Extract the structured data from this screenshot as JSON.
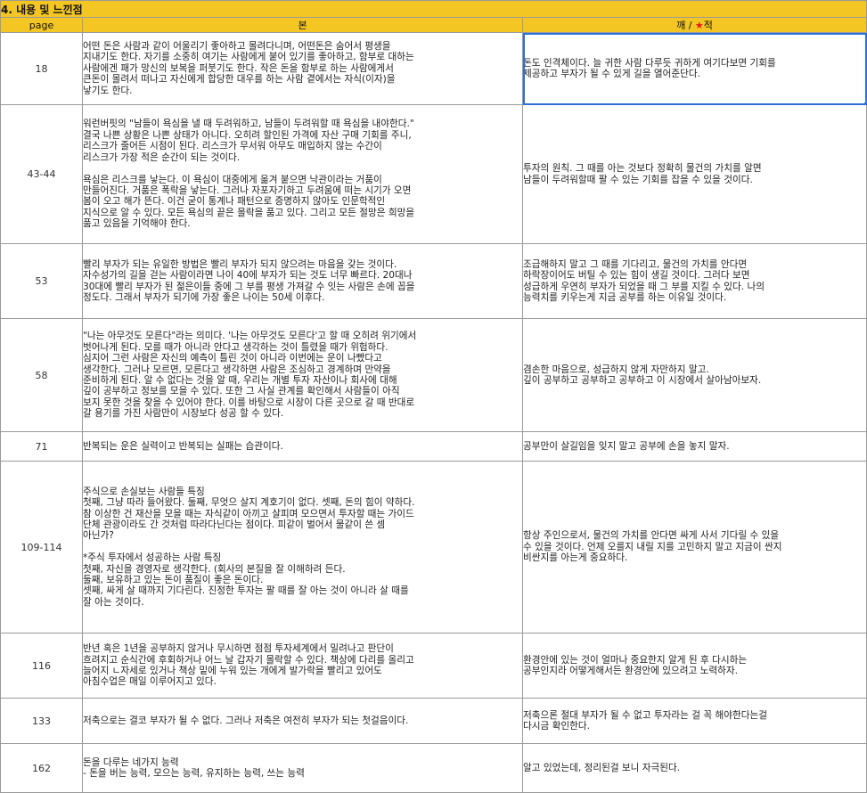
{
  "section_title": "4. 내용 및 느낀점",
  "headers": {
    "page": "page",
    "bon": "본",
    "kkae_prefix": "깨 / ",
    "star": "★",
    "kkae_suffix": "적"
  },
  "rows": [
    {
      "page": "18",
      "bon": "어떤 돈은 사람과 같이 어울리기 좋아하고 몰려다니며, 어떤돈은 숨어서 평생을\n지내기도 한다. 자기를 소중히 여기는 사람에게 붙어 있기를 좋아하고, 함부로 대하는\n사람에겐 패가 망신의 보복을 퍼붓기도 한다. 작은 돈을 함부로 하는 사람에게서\n큰돈이 몰려서 떠나고 자신에게 합당한 대우를 하는 사람 곁에서는 자식(이자)을\n낳기도 한다.",
      "kkae": "돈도 인격체이다. 늘 귀한 사람 다루듯 귀하게 여기다보면 기회를\n제공하고 부자가 될 수 있게 길을 열어준단다."
    },
    {
      "page": "43-44",
      "bon": "워런버핏의 \"남들이 욕심을 낼 때 두려워하고, 남들이 두려워할 때 욕심을 내야한다.\"\n결국 나쁜 상황은 나쁜 상태가 아니다. 오히려 할인된 가격에 자산 구매 기회를 주니,\n리스크가 줄어든 시점이 된다. 리스크가 무서워 아무도 매입하지 않는 수간이\n리스크가 가장 적은 순간이 되는 것이다.\n\n욕심은 리스크를 낳는다. 이 욕심이 대중에게 옮겨 붙으면 낙관이라는 거품이\n만들어진다. 거품은 폭락을 낳는다. 그러나 자포자기하고 두려움에 떠는 시기가 오면\n봄이 오고 해가 뜬다. 이건 굳이 통계나 패턴으로 증명하지 않아도 인문학적인\n지식으로 알 수 있다. 모든 욕심의 끝은 몰락을 품고 있다. 그리고 모든 절망은 희망을\n품고 있음을 기억해야 한다.",
      "kkae": "투자의 원칙. 그 때를 아는 것보다 정확히 물건의 가치를 알면\n남들이 두려워할때 팔 수 있는 기회를 잡을 수 있을 것이다."
    },
    {
      "page": "53",
      "bon": "빨리 부자가 되는 유일한 방법은 빨리 부자가 되지 않으려는 마음을 갖는 것이다.\n자수성가의 길을 걷는 사람이라면 나이 40에 부자가 되는 것도 너무 빠르다. 20대나\n30대에 빨리 부자가 된 젊은이들 중에 그 부를 평생 가져갈 수 잇는 사람은 손에 꼽을\n정도다. 그래서 부자가 되기에 가장 좋은 나이는 50세 이후다.",
      "kkae": "조급해하지 말고 그 때를 기다리고, 물건의 가치를 안다면\n하락장이어도 버틸 수 있는 힘이 생길 것이다. 그러다 보면\n성급하게 우연히 부자가 되었을 때 그 부를 지킬 수 있다.  나의\n능력치를 키우는게 지금 공부를 하는 이유일 것이다."
    },
    {
      "page": "58",
      "bon": "\"나는 아무것도 모른다\"라는 의미다. '나는 아무것도 모른다'고 할 때 오히려 위기에서\n벗어나게 된다. 모를 때가 아니라 안다고 생각하는 것이 틀렸을 때가 위험하다.\n심지어 그런 사람은 자신의 예측이 틀린 것이 아니라 이번에는 운이 나빴다고\n생각한다. 그러나 모르면, 모른다고 생각하면 사람은 조심하고 경계하며 만약을\n준비하게 된다. 알 수 없다는 것을 알 때, 우리는 개별 투자 자산이나 회사에 대해\n깊이 공부하고 정보를 모을 수 있다. 또한 그 사실 관계를 확인해서 사람들이 아직\n보지 못한 것을 찾을 수 있어야 한다. 이를 바탕으로 시장이 다른 곳으로 갈 때 반대로\n갈 용기를 가진 사람만이 시장보다 성공 할 수 있다.",
      "kkae": "겸손한 마음으로, 성급하지 않게 자만하지 말고.\n깊이 공부하고 공부하고 공부하고 이 시장에서 살아남아보자."
    },
    {
      "page": "71",
      "bon": "반복되는 운은 실력이고 반복되는 실패는 습관이다.",
      "kkae": "공부만이 살길임을 잊지 말고 공부에 손을 놓지 말자."
    },
    {
      "page": "109-114",
      "bon": "주식으로 손실보는 사람들 특징\n첫째, 그냥 따라 들어왔다. 둘째, 무엇으 살지 계호기이 없다. 셋째, 돈의 힘이 약하다.\n참 이상한 건 재산을 모을 때는 자식같이 아끼고 살피며 모으면서 투자할 때는 가이드\n단체 관광이라도 간 것처럼 따라다닌다는 점이다. 피같이 벌어서 물같이 쓴 셈\n아닌가?\n\n*주식 투자에서 성공하는 사람 특징\n첫째, 자신을 경영자로 생각한다. (회사의 본질을 잘 이해하려 든다.\n둘째, 보유하고 있는 돈이 품질이 좋은 돈이다.\n셋째, 싸게 살 때까지 기다린다. 진정한 투자는 팔 때를 잘 아는 것이 아니라 살 때를\n잘 아는 것이다.",
      "kkae": "항상 주인으로서, 물건의 가치를 안다면 싸게 사서 기다릴 수 있을\n수 있을 것이다. 언제 오를지 내릴 지를 고민하지 말고 지금이 싼지\n비싼지를 아는게 중요하다."
    },
    {
      "page": "116",
      "bon": "반년 혹은 1년을 공부하지 않거나 무시하면 점점 투자세계에서 밀려나고 판단이\n흐려지고 순식간에 후회하거나 어느 날 갑자기 몰락할 수 있다. 책상에 다리를 올리고\n늘어지 ㄴ자세로 있거나 책상 밑에 누워 있는 개에게 발가락을 빨리고 있어도\n아침수업은 매일 이루어지고 있다.",
      "kkae": "환경안에 있는 것이 얼마나 중요한지 알게 된 후 다시하는\n공부인지라 어떻게해서든 환경안에 있으려고 노력하자."
    },
    {
      "page": "133",
      "bon": "저축으로는 결코 부자가 될 수 없다. 그러나 저축은 여전히 부자가 되는 첫걸음이다.",
      "kkae": "저축으론 절대 부자가 될 수 없고 투자라는 걸 꼭 해야한다는걸\n다시금 확인한다."
    },
    {
      "page": "162",
      "bon": "돈을 다루는 네가지 능력\n - 돈을 버는 능력, 모으는 능력, 유지하는 능력, 쓰는 능력",
      "kkae": "알고 있었는데, 정리된걸 보니 자극된다."
    }
  ]
}
